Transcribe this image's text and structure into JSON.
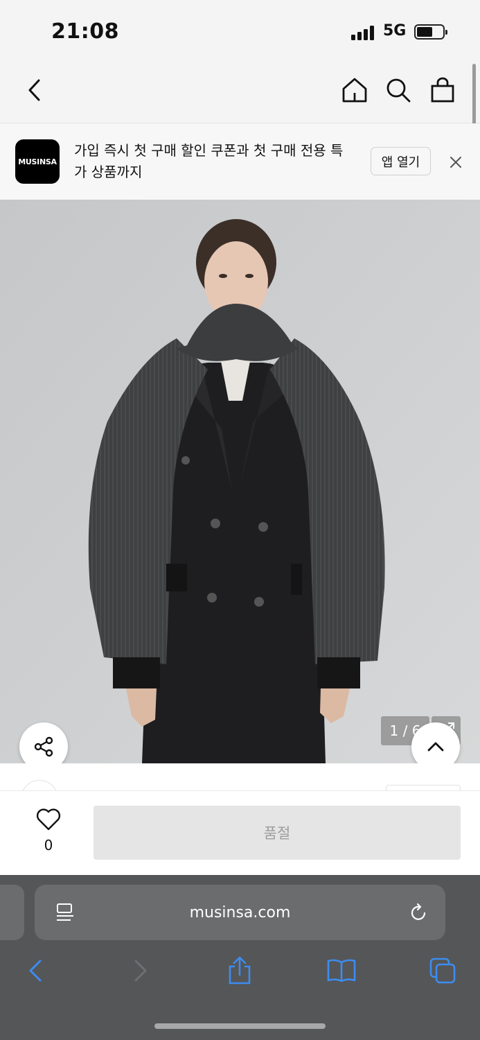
{
  "status_bar": {
    "time": "21:08",
    "network": "5G"
  },
  "nav": {
    "back": "back",
    "home": "home",
    "search": "search",
    "cart": "cart"
  },
  "banner": {
    "logo": "MUSINSA",
    "text": "가입 즉시 첫 구매 할인 쿠폰과 첫 구매 전용 특가 상품까지",
    "open_app": "앱 열기"
  },
  "gallery": {
    "counter": "1 / 6"
  },
  "purchase": {
    "like_count": "0",
    "buy_label": "품절"
  },
  "safari": {
    "url": "musinsa.com"
  },
  "colors": {
    "soldout_bg": "#e5e5e5",
    "safari_bar": "#555658",
    "accent_blue": "#3d8cf0"
  }
}
